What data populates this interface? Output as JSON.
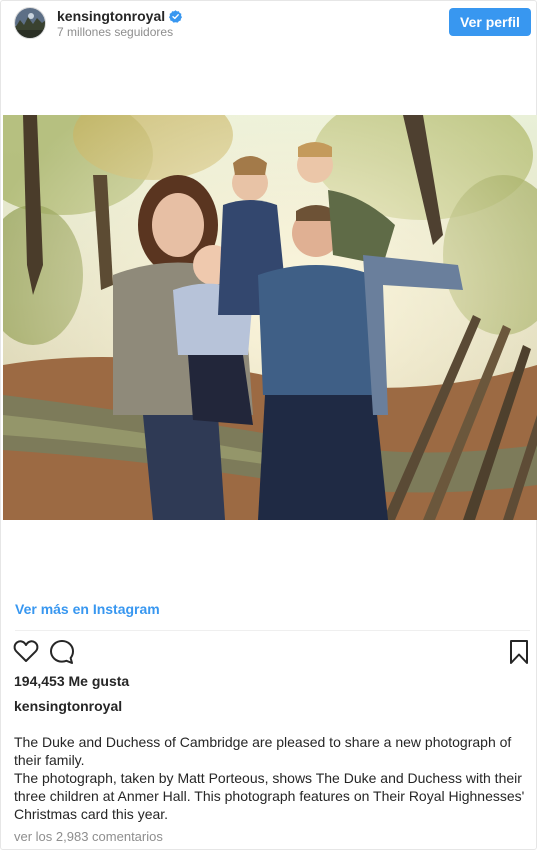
{
  "header": {
    "username": "kensingtonroyal",
    "followers": "7 millones seguidores",
    "view_profile_label": "Ver perfil"
  },
  "post": {
    "image_alt": "The Duke and Duchess of Cambridge with their three children at Anmer Hall",
    "view_more_label": "Ver más en Instagram",
    "likes": "194,453 Me gusta",
    "caption_username": "kensingtonroyal",
    "caption_line_1": "The Duke and Duchess of Cambridge are pleased to share a new photograph of their family.",
    "caption_line_2": "The photograph, taken by Matt Porteous, shows The Duke and Duchess with their three children at Anmer Hall. This photograph features on Their Royal Highnesses' Christmas card this year.",
    "comments_link": "ver los 2,983 comentarios"
  },
  "icons": {
    "verified": "verified-badge-icon",
    "like": "heart-icon",
    "comment": "comment-bubble-icon",
    "save": "bookmark-icon"
  },
  "colors": {
    "accent": "#3897f0",
    "text": "#262626",
    "muted": "#8e8e8e"
  }
}
